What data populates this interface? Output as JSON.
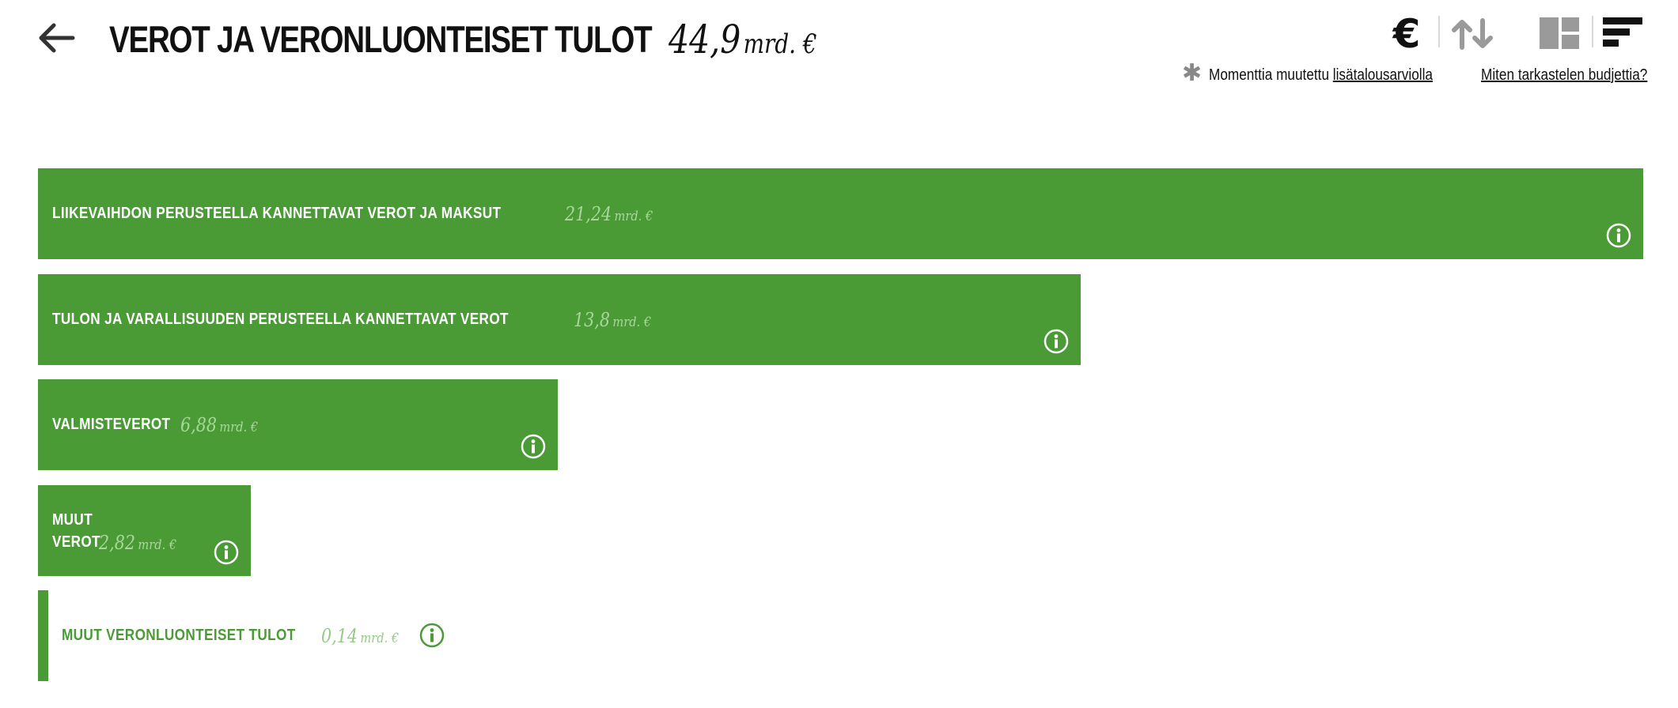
{
  "header": {
    "title": "VEROT JA VERONLUONTEISET TULOT",
    "total_value": "44,9",
    "total_unit": "mrd. €"
  },
  "toolbar": {
    "currency_symbol": "€",
    "icons": [
      "back-arrow-icon",
      "euro-icon",
      "sort-arrows-icon",
      "treemap-view-icon",
      "bar-view-icon"
    ]
  },
  "note": {
    "star": "✱",
    "text": "Momenttia muutettu",
    "link": "lisätalousarviolla",
    "help_link": "Miten tarkastelen budjettia?"
  },
  "colors": {
    "bar": "#4a9b36",
    "value_text": "#a9d79b",
    "text_dark": "#111111",
    "icon_inactive": "#9a9a9a"
  },
  "chart_data": {
    "type": "bar",
    "orientation": "horizontal",
    "unit": "mrd. €",
    "total": 44.9,
    "categories": [
      "LIIKEVAIHDON PERUSTEELLA KANNETTAVAT VEROT JA MAKSUT",
      "TULON JA VARALLISUUDEN PERUSTEELLA KANNETTAVAT VEROT",
      "VALMISTEVEROT",
      "MUUT VEROT",
      "MUUT VERONLUONTEISET TULOT"
    ],
    "values": [
      21.24,
      13.8,
      6.88,
      2.82,
      0.14
    ],
    "value_labels": [
      "21,24",
      "13,8",
      "6,88",
      "2,82",
      "0,14"
    ],
    "name_lines": [
      [
        "LIIKEVAIHDON PERUSTEELLA KANNETTAVAT VEROT JA MAKSUT"
      ],
      [
        "TULON JA VARALLISUUDEN PERUSTEELLA KANNETTAVAT VEROT"
      ],
      [
        "VALMISTEVEROT"
      ],
      [
        "MUUT",
        "VEROT"
      ],
      [
        "MUUT VERONLUONTEISET TULOT"
      ]
    ]
  }
}
